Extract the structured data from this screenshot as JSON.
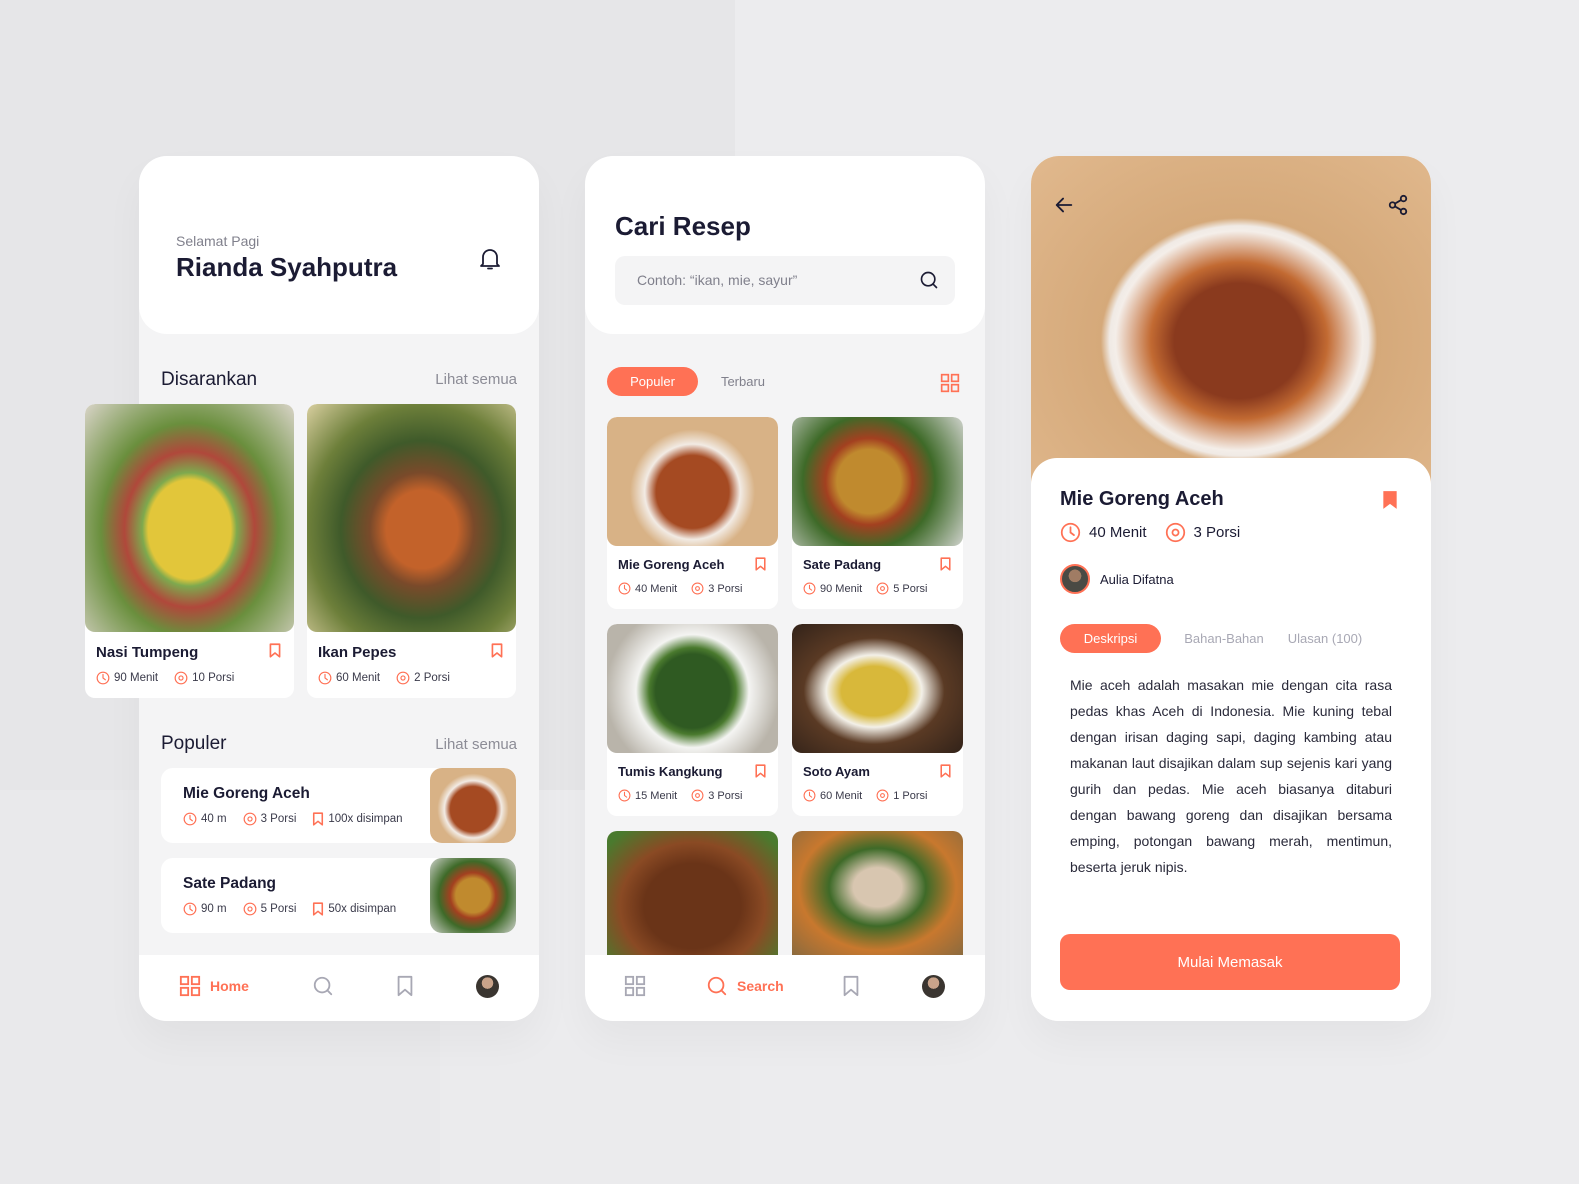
{
  "colors": {
    "accent": "#ff7155",
    "text_dark": "#1b1b33",
    "text_muted": "#80808c",
    "background": "#ececee"
  },
  "home": {
    "greeting": "Selamat Pagi",
    "user_name": "Rianda Syahputra",
    "notification_icon": "bell-icon",
    "suggested": {
      "title": "Disarankan",
      "see_all": "Lihat semua",
      "items": [
        {
          "name": "Nasi Tumpeng",
          "time": "90 Menit",
          "portions": "10 Porsi"
        },
        {
          "name": "Ikan Pepes",
          "time": "60 Menit",
          "portions": "2 Porsi"
        }
      ]
    },
    "popular": {
      "title": "Populer",
      "see_all": "Lihat semua",
      "items": [
        {
          "name": "Mie Goreng Aceh",
          "time": "40 m",
          "portions": "3 Porsi",
          "saved": "100x disimpan"
        },
        {
          "name": "Sate Padang",
          "time": "90 m",
          "portions": "5 Porsi",
          "saved": "50x disimpan"
        }
      ]
    },
    "nav": {
      "home": "Home"
    }
  },
  "search": {
    "title": "Cari Resep",
    "placeholder": "Contoh: “ikan, mie, sayur”",
    "filters": [
      {
        "label": "Populer",
        "active": true
      },
      {
        "label": "Terbaru",
        "active": false
      }
    ],
    "results": [
      {
        "name": "Mie Goreng Aceh",
        "time": "40 Menit",
        "portions": "3 Porsi"
      },
      {
        "name": "Sate Padang",
        "time": "90 Menit",
        "portions": "5 Porsi"
      },
      {
        "name": "Tumis Kangkung",
        "time": "15 Menit",
        "portions": "3 Porsi"
      },
      {
        "name": "Soto Ayam",
        "time": "60 Menit",
        "portions": "1 Porsi"
      }
    ],
    "nav": {
      "search": "Search"
    }
  },
  "detail": {
    "title": "Mie Goreng Aceh",
    "time": "40 Menit",
    "portions": "3 Porsi",
    "author": "Aulia Difatna",
    "tabs": [
      {
        "label": "Deskripsi",
        "active": true
      },
      {
        "label": "Bahan-Bahan",
        "active": false
      },
      {
        "label": "Ulasan (100)",
        "active": false
      }
    ],
    "description": "Mie aceh adalah masakan mie dengan cita rasa pedas khas Aceh di Indonesia. Mie kuning tebal dengan irisan daging sapi, daging kambing atau makanan laut disajikan dalam sup sejenis kari yang gurih dan pedas. Mie aceh biasanya ditaburi dengan bawang goreng dan disajikan bersama emping, potongan bawang merah, mentimun, beserta jeruk nipis.",
    "cta": "Mulai Memasak"
  }
}
